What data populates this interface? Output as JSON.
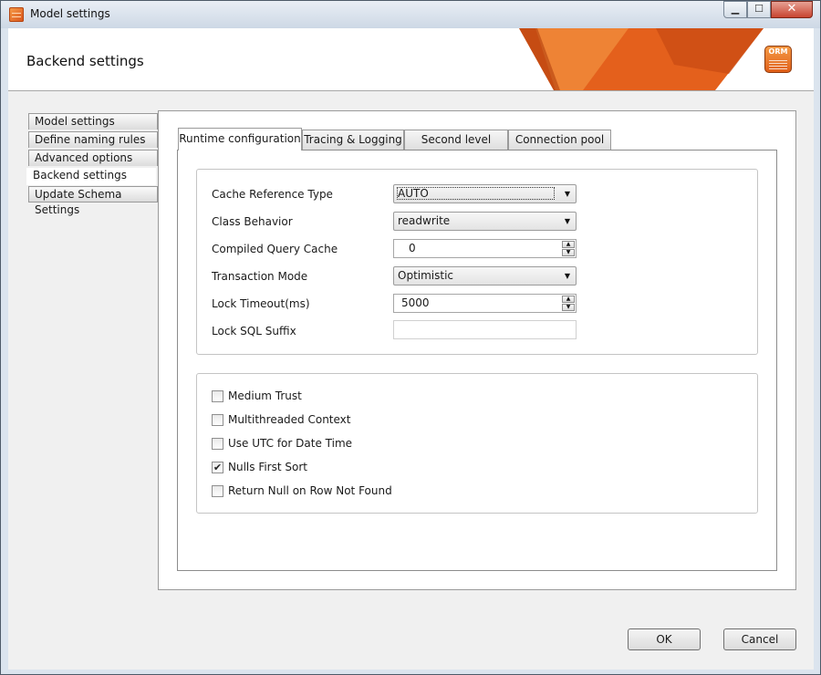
{
  "window": {
    "title": "Model settings",
    "controls": {
      "minimize": "▁",
      "maximize": "☐",
      "close": "✕"
    }
  },
  "header": {
    "title": "Backend settings",
    "logo_text": "ORM",
    "accent_color": "#e4601c"
  },
  "sidebar": {
    "items": [
      {
        "label": "Model settings",
        "selected": false
      },
      {
        "label": "Define naming rules",
        "selected": false
      },
      {
        "label": "Advanced options",
        "selected": false
      },
      {
        "label": "Backend settings",
        "selected": true
      },
      {
        "label": "Update Schema Settings",
        "selected": false
      }
    ]
  },
  "tabs": [
    {
      "label": "Runtime configuration",
      "active": true
    },
    {
      "label": "Tracing & Logging",
      "active": false
    },
    {
      "label": "Second level cache",
      "active": false
    },
    {
      "label": "Connection pool",
      "active": false
    }
  ],
  "runtime": {
    "cache_reference_type": {
      "label": "Cache Reference Type",
      "value": "AUTO"
    },
    "class_behavior": {
      "label": "Class Behavior",
      "value": "readwrite"
    },
    "compiled_query_cache": {
      "label": "Compiled Query Cache",
      "value": "0"
    },
    "transaction_mode": {
      "label": "Transaction Mode",
      "value": "Optimistic"
    },
    "lock_timeout": {
      "label": "Lock Timeout(ms)",
      "value": "5000"
    },
    "lock_sql_suffix": {
      "label": "Lock SQL Suffix",
      "value": ""
    }
  },
  "options": [
    {
      "label": "Medium Trust",
      "checked": false
    },
    {
      "label": "Multithreaded Context",
      "checked": false
    },
    {
      "label": "Use UTC for Date Time",
      "checked": false
    },
    {
      "label": "Nulls First Sort",
      "checked": true
    },
    {
      "label": "Return Null on Row Not Found",
      "checked": false
    }
  ],
  "icons": {
    "dropdown_arrow": "▼",
    "spin_up": "▲",
    "spin_down": "▼",
    "check_mark": "✔"
  },
  "footer": {
    "ok_label": "OK",
    "cancel_label": "Cancel"
  }
}
